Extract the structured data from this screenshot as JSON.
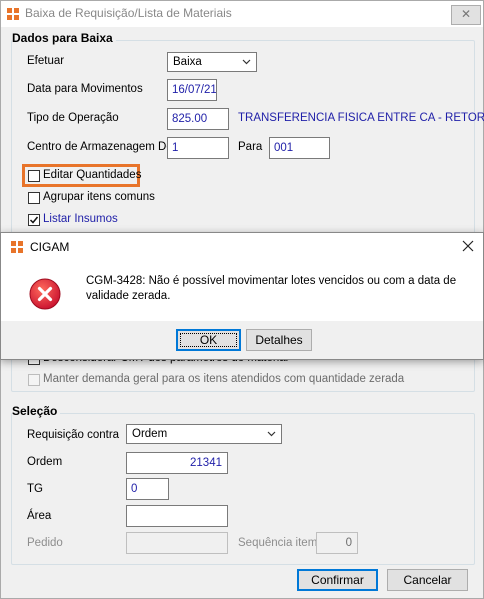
{
  "window": {
    "title": "Baixa de Requisição/Lista de Materiais",
    "close_label": "✕"
  },
  "baixa": {
    "section_title": "Dados para Baixa",
    "efetuar_label": "Efetuar",
    "efetuar_value": "Baixa",
    "data_label": "Data para Movimentos",
    "data_value": "16/07/21",
    "tipo_label": "Tipo de Operação",
    "tipo_value": "825.00",
    "tipo_desc": "TRANSFERENCIA FISICA ENTRE CA - RETORNO",
    "centro_label": "Centro de Armazenagem De",
    "centro_de_value": "1",
    "centro_para_label": "Para",
    "centro_para_value": "001",
    "editar_label": "Editar Quantidades",
    "agrupar_label": "Agrupar itens comuns",
    "listar_label": "Listar Insumos",
    "desconsiderar_label": "Desconsiderar CMT dos parâmetros do material",
    "manter_label": "Manter demanda geral para os itens atendidos com quantidade zerada"
  },
  "selecao": {
    "section_title": "Seleção",
    "requisicao_label": "Requisição contra",
    "requisicao_value": "Ordem",
    "ordem_label": "Ordem",
    "ordem_value": "21341",
    "tg_label": "TG",
    "tg_value": "0",
    "area_label": "Área",
    "area_value": "",
    "pedido_label": "Pedido",
    "pedido_value": "",
    "sequencia_label": "Sequência item",
    "sequencia_value": "0"
  },
  "footer": {
    "confirmar_label": "Confirmar",
    "cancelar_label": "Cancelar"
  },
  "dialog": {
    "title": "CIGAM",
    "message": "CGM-3428: Não é possível movimentar lotes vencidos ou com a data de validade zerada.",
    "ok_label": "OK",
    "detalhes_label": "Detalhes"
  },
  "colors": {
    "accent": "#e8742a",
    "error": "#e81123",
    "link_text": "#1f1fa8"
  }
}
